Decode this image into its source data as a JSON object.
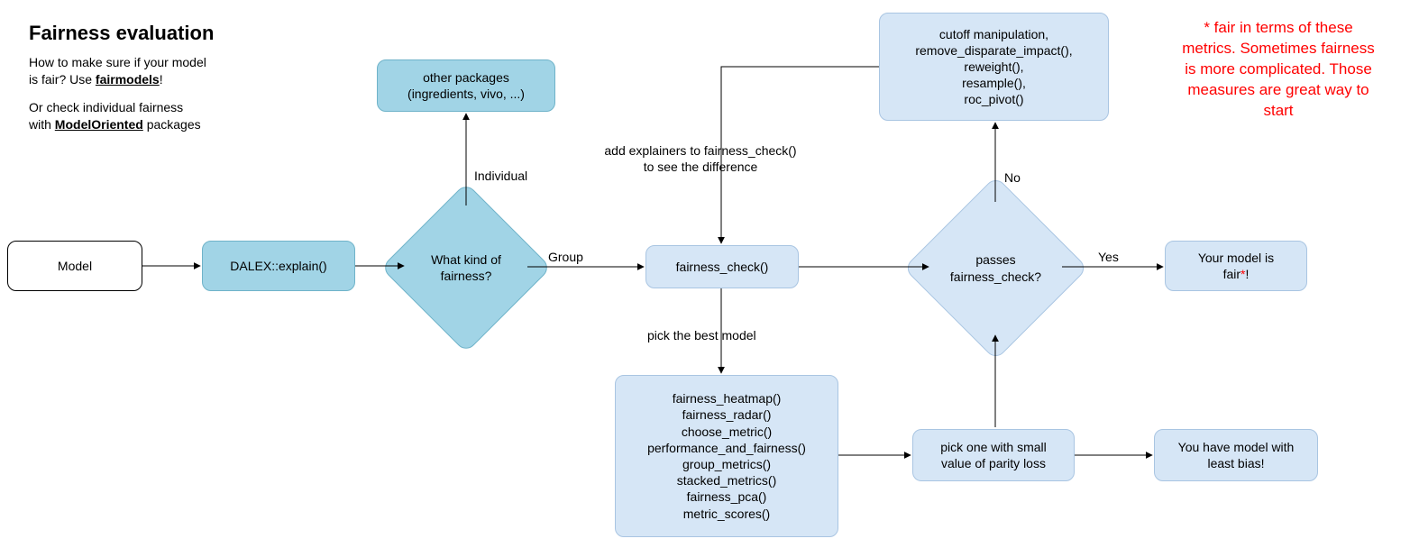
{
  "title": "Fairness evaluation",
  "subtitle1_a": "How to make sure if your model\nis fair? Use ",
  "subtitle1_b": "fairmodels",
  "subtitle1_c": "!",
  "subtitle2_a": "Or check individual fairness\nwith ",
  "subtitle2_b": "ModelOriented",
  "subtitle2_c": " packages",
  "nodes": {
    "model": "Model",
    "explain": "DALEX::explain()",
    "decision1": "What kind of\nfairness?",
    "other_pkgs": "other packages\n(ingredients, vivo, ...)",
    "fairness_check": "fairness_check()",
    "mitigation": "cutoff manipulation,\nremove_disparate_impact(),\nreweight(),\nresample(),\nroc_pivot()",
    "decision2": "passes\nfairness_check?",
    "fair": "Your model is\nfair*!",
    "visuals": "fairness_heatmap()\nfairness_radar()\nchoose_metric()\nperformance_and_fairness()\ngroup_metrics()\nstacked_metrics()\nfairness_pca()\nmetric_scores()",
    "pickone": "pick one with small\nvalue of parity loss",
    "leastbias": "You have model with\nleast bias!"
  },
  "labels": {
    "individual": "Individual",
    "group": "Group",
    "add_expl": "add explainers to fairness_check()\nto see the difference",
    "pick_best": "pick the best model",
    "no": "No",
    "yes": "Yes"
  },
  "footnote": "* fair in terms of these\nmetrics. Sometimes fairness\nis more complicated. Those\nmeasures are great way to\nstart"
}
